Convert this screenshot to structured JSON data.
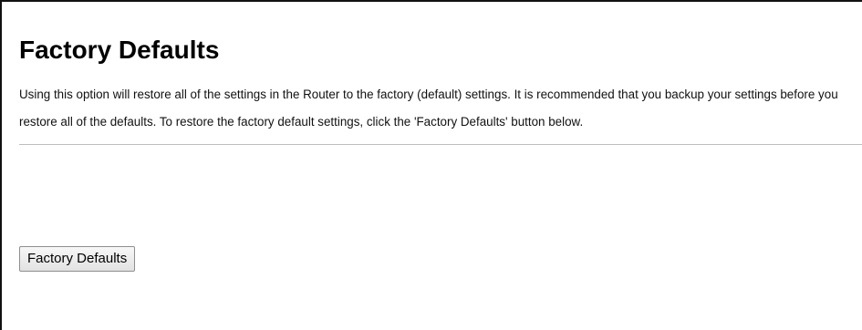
{
  "page": {
    "title": "Factory Defaults",
    "description": "Using this option will restore all of the settings in the Router to the factory (default) settings. It is recommended that you backup your settings before you restore all of the defaults. To restore the factory default settings, click the 'Factory Defaults' button below."
  },
  "actions": {
    "factory_defaults_label": "Factory Defaults"
  }
}
